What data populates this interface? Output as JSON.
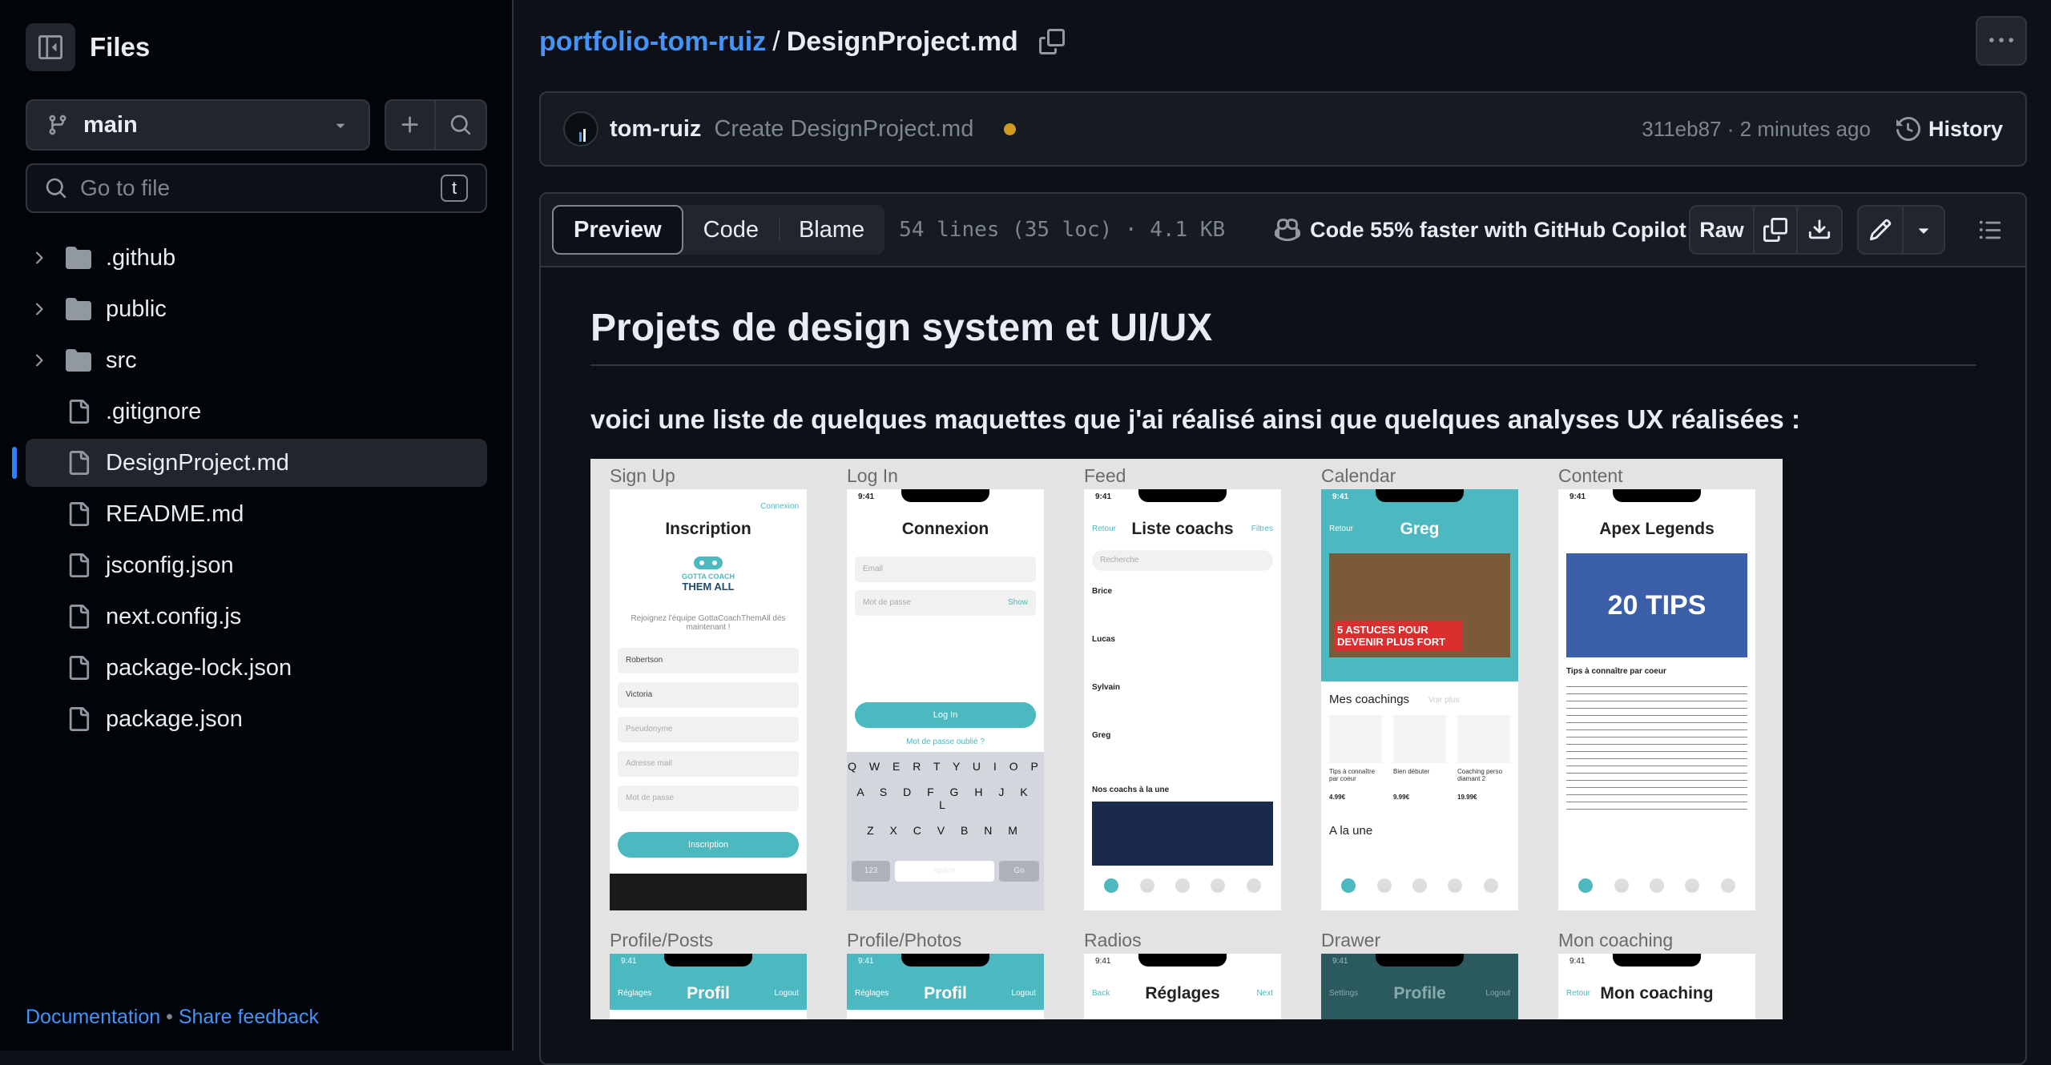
{
  "sidebar": {
    "title": "Files",
    "branch": "main",
    "goto_placeholder": "Go to file",
    "goto_shortcut": "t",
    "items": [
      {
        "name": ".github",
        "type": "folder"
      },
      {
        "name": "public",
        "type": "folder"
      },
      {
        "name": "src",
        "type": "folder"
      },
      {
        "name": ".gitignore",
        "type": "file"
      },
      {
        "name": "DesignProject.md",
        "type": "file",
        "active": true
      },
      {
        "name": "README.md",
        "type": "file"
      },
      {
        "name": "jsconfig.json",
        "type": "file"
      },
      {
        "name": "next.config.js",
        "type": "file"
      },
      {
        "name": "package-lock.json",
        "type": "file"
      },
      {
        "name": "package.json",
        "type": "file"
      }
    ],
    "footer": {
      "documentation": "Documentation",
      "separator": "•",
      "feedback": "Share feedback"
    }
  },
  "breadcrumb": {
    "repo": "portfolio-tom-ruiz",
    "separator": "/",
    "file": "DesignProject.md"
  },
  "commit": {
    "author": "tom-ruiz",
    "message": "Create DesignProject.md",
    "meta": "311eb87 · 2 minutes ago",
    "history": "History"
  },
  "file_bar": {
    "tabs": [
      "Preview",
      "Code",
      "Blame"
    ],
    "active_tab": "Preview",
    "lines": "54 lines (35 loc) · 4.1 KB",
    "copilot": "Code 55% faster with GitHub Copilot",
    "raw": "Raw"
  },
  "markdown": {
    "heading": "Projets de design system et UI/UX",
    "subheading": "voici une liste de quelques maquettes que j'ai réalisé ainsi que quelques analyses UX réalisées :"
  },
  "mockup": {
    "row1_labels": [
      "Sign Up",
      "Log In",
      "Feed",
      "Calendar",
      "Content"
    ],
    "row2_labels": [
      "Profile/Posts",
      "Profile/Photos",
      "Radios",
      "Drawer",
      "Mon coaching"
    ],
    "signup": {
      "title": "Inscription",
      "link": "Connexion",
      "brand_line1": "GOTTA COACH",
      "brand_line2": "THEM ALL",
      "tagline": "Rejoignez l'équipe GottaCoachThemAll dès maintenant !",
      "fields": [
        "Robertson",
        "Victoria",
        "Pseudonyme",
        "Adresse mail",
        "Mot de passe"
      ],
      "button": "Inscription"
    },
    "login": {
      "title": "Connexion",
      "fields": [
        "Email",
        "Mot de passe"
      ],
      "show": "Show",
      "button": "Log In",
      "forgot": "Mot de passe oublié ?",
      "time": "9:41",
      "key_row1": "Q W E R T Y U I O P",
      "key_row2": "A S D F G H J K L",
      "key_row3": "Z X C V B N M",
      "key_num": "123",
      "key_space": "space",
      "key_go": "Go"
    },
    "feed": {
      "title": "Liste coachs",
      "back": "Retour",
      "filters": "Filtres",
      "search": "Recherche",
      "time": "9:41",
      "coaches": [
        "Brice",
        "Lucas",
        "Sylvain",
        "Greg"
      ],
      "section": "Nos coachs à la une"
    },
    "calendar": {
      "title": "Greg",
      "back": "Retour",
      "time": "9:41",
      "banner": "5 ASTUCES POUR DEVENIR PLUS FORT",
      "section": "Mes coachings",
      "see_more": "Voir plus",
      "cards": [
        "Tips à connaître par coeur",
        "Bien débuter",
        "Coaching perso diamant 2"
      ],
      "prices": [
        "4.99€",
        "9.99€",
        "19.99€"
      ],
      "section2": "A la une"
    },
    "content": {
      "title": "Apex Legends",
      "time": "9:41",
      "banner": "20 TIPS",
      "subtitle": "Tips à connaître par coeur"
    },
    "profile_posts": {
      "title": "Profil",
      "left": "Réglages",
      "right": "Logout",
      "time": "9:41"
    },
    "profile_photos": {
      "title": "Profil",
      "left": "Réglages",
      "right": "Logout",
      "time": "9:41"
    },
    "radios": {
      "title": "Réglages",
      "left": "Back",
      "right": "Next",
      "time": "9:41"
    },
    "drawer": {
      "title": "Profile",
      "left": "Settings",
      "right": "Logout",
      "time": "9:41"
    },
    "mon_coaching": {
      "title": "Mon coaching",
      "left": "Retour",
      "time": "9:41"
    }
  },
  "colors": {
    "accent": "#4493f8",
    "teal": "#4cb8c0",
    "commit_dot": "#d29922"
  }
}
